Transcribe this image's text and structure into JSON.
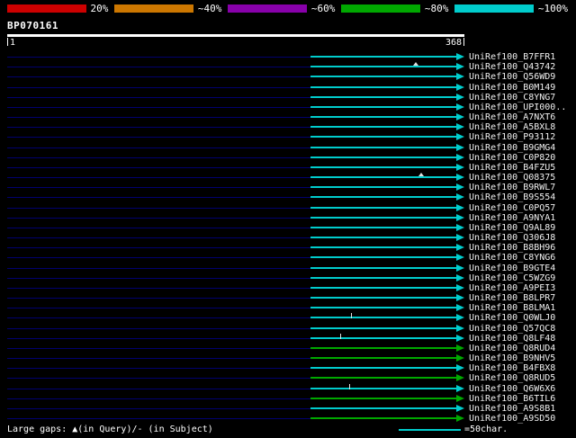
{
  "query": {
    "name": "BP070161",
    "start_label": "1",
    "end_label": "368"
  },
  "colors": {
    "baseline": "#00006e",
    "cyan": "#00cccc",
    "green": "#00a800",
    "ruler": "#ffffff"
  },
  "legend": {
    "gaps_text": "Large gaps: ▲(in Query)/- (in Subject)",
    "scale_text": "=50char."
  },
  "chart_data": {
    "type": "bar",
    "subtype": "blast-alignment-overview",
    "title": "BP070161",
    "query_length": 368,
    "x_range": [
      1,
      368
    ],
    "legend_position": "top",
    "identity_legend": [
      {
        "label": "20%",
        "color": "#cc0000"
      },
      {
        "label": "~40%",
        "color": "#cc7700"
      },
      {
        "label": "~60%",
        "color": "#8800aa"
      },
      {
        "label": "~80%",
        "color": "#00a800"
      },
      {
        "label": "~100%",
        "color": "#00cccc"
      }
    ],
    "hits": [
      {
        "label": "UniRef100_B7FFR1",
        "color_key": "cyan",
        "identity": "~100%",
        "start": 244,
        "end": 368,
        "markers": []
      },
      {
        "label": "UniRef100_Q43742",
        "color_key": "cyan",
        "identity": "~100%",
        "start": 244,
        "end": 368,
        "markers": [
          {
            "type": "gap-query",
            "pos": 329
          }
        ]
      },
      {
        "label": "UniRef100_Q56WD9",
        "color_key": "cyan",
        "identity": "~100%",
        "start": 244,
        "end": 368,
        "markers": []
      },
      {
        "label": "UniRef100_B0M149",
        "color_key": "cyan",
        "identity": "~100%",
        "start": 244,
        "end": 368,
        "markers": []
      },
      {
        "label": "UniRef100_C8YNG7",
        "color_key": "cyan",
        "identity": "~100%",
        "start": 244,
        "end": 368,
        "markers": []
      },
      {
        "label": "UniRef100_UPI000..",
        "color_key": "cyan",
        "identity": "~100%",
        "start": 244,
        "end": 368,
        "markers": []
      },
      {
        "label": "UniRef100_A7NXT6",
        "color_key": "cyan",
        "identity": "~100%",
        "start": 244,
        "end": 368,
        "markers": []
      },
      {
        "label": "UniRef100_A5BXL8",
        "color_key": "cyan",
        "identity": "~100%",
        "start": 244,
        "end": 368,
        "markers": []
      },
      {
        "label": "UniRef100_P93112",
        "color_key": "cyan",
        "identity": "~100%",
        "start": 244,
        "end": 368,
        "markers": []
      },
      {
        "label": "UniRef100_B9GMG4",
        "color_key": "cyan",
        "identity": "~100%",
        "start": 244,
        "end": 368,
        "markers": []
      },
      {
        "label": "UniRef100_C0P820",
        "color_key": "cyan",
        "identity": "~100%",
        "start": 244,
        "end": 368,
        "markers": []
      },
      {
        "label": "UniRef100_B4FZU5",
        "color_key": "cyan",
        "identity": "~100%",
        "start": 244,
        "end": 368,
        "markers": []
      },
      {
        "label": "UniRef100_Q08375",
        "color_key": "cyan",
        "identity": "~100%",
        "start": 244,
        "end": 368,
        "markers": [
          {
            "type": "gap-query",
            "pos": 333
          }
        ]
      },
      {
        "label": "UniRef100_B9RWL7",
        "color_key": "cyan",
        "identity": "~100%",
        "start": 244,
        "end": 368,
        "markers": []
      },
      {
        "label": "UniRef100_B9S554",
        "color_key": "cyan",
        "identity": "~100%",
        "start": 244,
        "end": 368,
        "markers": []
      },
      {
        "label": "UniRef100_C0PQ57",
        "color_key": "cyan",
        "identity": "~100%",
        "start": 244,
        "end": 368,
        "markers": []
      },
      {
        "label": "UniRef100_A9NYA1",
        "color_key": "cyan",
        "identity": "~100%",
        "start": 244,
        "end": 368,
        "markers": []
      },
      {
        "label": "UniRef100_Q9AL89",
        "color_key": "cyan",
        "identity": "~100%",
        "start": 244,
        "end": 368,
        "markers": []
      },
      {
        "label": "UniRef100_Q306J8",
        "color_key": "cyan",
        "identity": "~100%",
        "start": 244,
        "end": 368,
        "markers": []
      },
      {
        "label": "UniRef100_B8BH96",
        "color_key": "cyan",
        "identity": "~100%",
        "start": 244,
        "end": 368,
        "markers": []
      },
      {
        "label": "UniRef100_C8YNG6",
        "color_key": "cyan",
        "identity": "~100%",
        "start": 244,
        "end": 368,
        "markers": []
      },
      {
        "label": "UniRef100_B9GTE4",
        "color_key": "cyan",
        "identity": "~100%",
        "start": 244,
        "end": 368,
        "markers": []
      },
      {
        "label": "UniRef100_C5WZG9",
        "color_key": "cyan",
        "identity": "~100%",
        "start": 244,
        "end": 368,
        "markers": []
      },
      {
        "label": "UniRef100_A9PEI3",
        "color_key": "cyan",
        "identity": "~100%",
        "start": 244,
        "end": 368,
        "markers": []
      },
      {
        "label": "UniRef100_B8LPR7",
        "color_key": "cyan",
        "identity": "~100%",
        "start": 244,
        "end": 368,
        "markers": []
      },
      {
        "label": "UniRef100_B8LMA1",
        "color_key": "cyan",
        "identity": "~100%",
        "start": 244,
        "end": 368,
        "markers": []
      },
      {
        "label": "UniRef100_Q0WLJ0",
        "color_key": "cyan",
        "identity": "~100%",
        "start": 244,
        "end": 368,
        "markers": [
          {
            "type": "gap-subject",
            "pos": 277
          }
        ]
      },
      {
        "label": "UniRef100_Q57QC8",
        "color_key": "cyan",
        "identity": "~100%",
        "start": 244,
        "end": 368,
        "markers": []
      },
      {
        "label": "UniRef100_Q8LF48",
        "color_key": "cyan",
        "identity": "~100%",
        "start": 244,
        "end": 368,
        "markers": [
          {
            "type": "gap-subject",
            "pos": 268
          }
        ]
      },
      {
        "label": "UniRef100_Q8RUD4",
        "color_key": "green",
        "identity": "~80%",
        "start": 244,
        "end": 368,
        "markers": []
      },
      {
        "label": "UniRef100_B9NHV5",
        "color_key": "green",
        "identity": "~80%",
        "start": 244,
        "end": 368,
        "markers": []
      },
      {
        "label": "UniRef100_B4FBX8",
        "color_key": "cyan",
        "identity": "~100%",
        "start": 244,
        "end": 368,
        "markers": []
      },
      {
        "label": "UniRef100_Q8RUD5",
        "color_key": "green",
        "identity": "~80%",
        "start": 244,
        "end": 368,
        "markers": []
      },
      {
        "label": "UniRef100_Q6W6X6",
        "color_key": "cyan",
        "identity": "~100%",
        "start": 244,
        "end": 368,
        "markers": [
          {
            "type": "gap-subject",
            "pos": 275
          }
        ]
      },
      {
        "label": "UniRef100_B6TIL6",
        "color_key": "green",
        "identity": "~80%",
        "start": 244,
        "end": 368,
        "markers": []
      },
      {
        "label": "UniRef100_A9S8B1",
        "color_key": "cyan",
        "identity": "~100%",
        "start": 244,
        "end": 368,
        "markers": []
      },
      {
        "label": "UniRef100_A9SD50",
        "color_key": "green",
        "identity": "~80%",
        "start": 244,
        "end": 368,
        "markers": []
      }
    ]
  }
}
